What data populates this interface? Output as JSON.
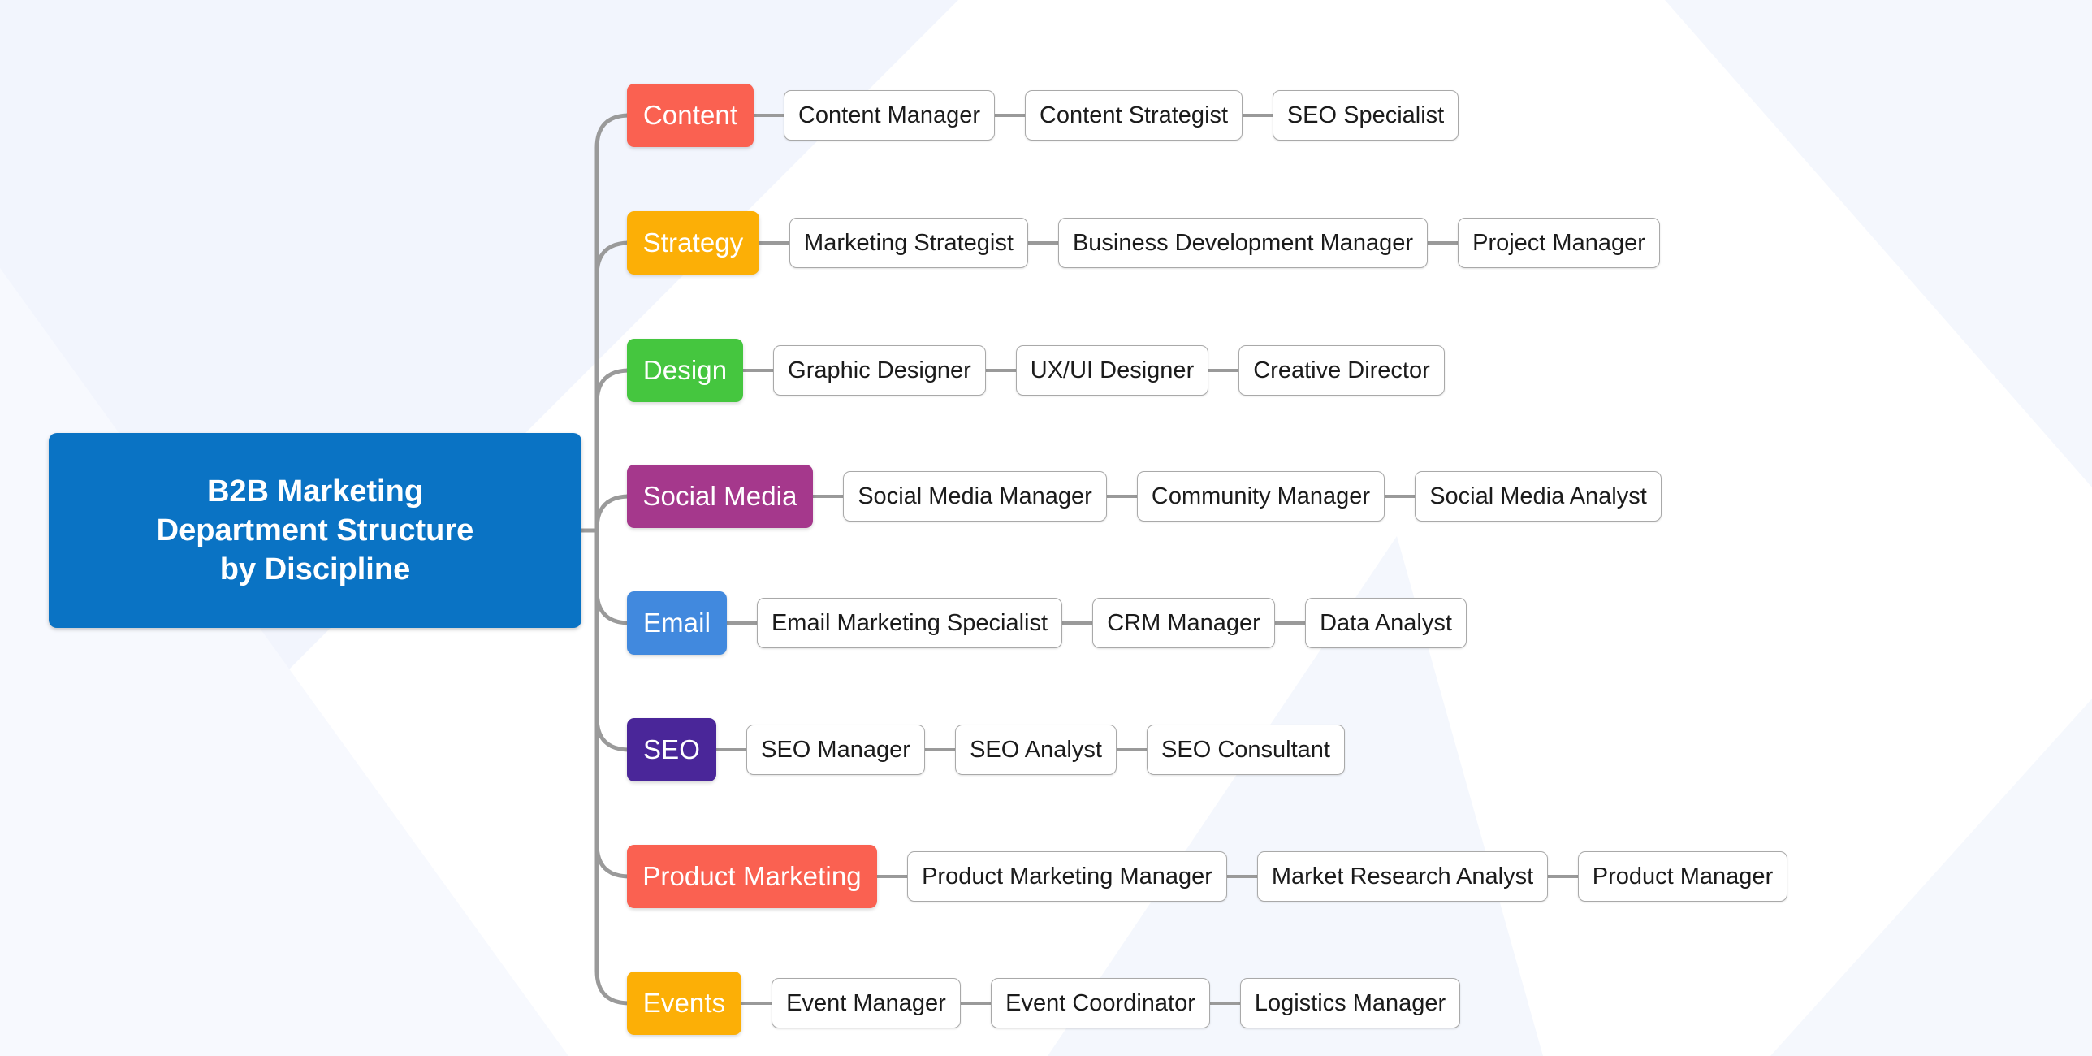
{
  "diagram": {
    "type": "mind-map",
    "title": "B2B Marketing Department Structure by Discipline",
    "background_color": "#ffffff",
    "accent_color": "#0a73c4",
    "connector_color": "#9a9a9a",
    "leaf_border_color": "#a9a9a9",
    "leaf_text_color": "#1b1b1b"
  },
  "root": {
    "lines": [
      "B2B Marketing",
      "Department Structure",
      "by Discipline"
    ],
    "color": "#0a73c4",
    "text_color": "#ffffff"
  },
  "branches": [
    {
      "label": "Content",
      "color": "#fa6151",
      "children": [
        "Content Manager",
        "Content Strategist",
        "SEO Specialist"
      ]
    },
    {
      "label": "Strategy",
      "color": "#fcaf06",
      "children": [
        "Marketing Strategist",
        "Business Development Manager",
        "Project Manager"
      ]
    },
    {
      "label": "Design",
      "color": "#45c63f",
      "children": [
        "Graphic Designer",
        "UX/UI Designer",
        "Creative Director"
      ]
    },
    {
      "label": "Social Media",
      "color": "#a5388c",
      "children": [
        "Social Media Manager",
        "Community Manager",
        "Social Media Analyst"
      ]
    },
    {
      "label": "Email",
      "color": "#4189de",
      "children": [
        "Email Marketing Specialist",
        "CRM Manager",
        "Data Analyst"
      ]
    },
    {
      "label": "SEO",
      "color": "#4a2699",
      "children": [
        "SEO Manager",
        "SEO Analyst",
        "SEO Consultant"
      ]
    },
    {
      "label": "Product Marketing",
      "color": "#fa6151",
      "children": [
        "Product Marketing Manager",
        "Market Research Analyst",
        "Product Manager"
      ]
    },
    {
      "label": "Events",
      "color": "#fcaf06",
      "children": [
        "Event Manager",
        "Event Coordinator",
        "Logistics Manager"
      ]
    }
  ]
}
